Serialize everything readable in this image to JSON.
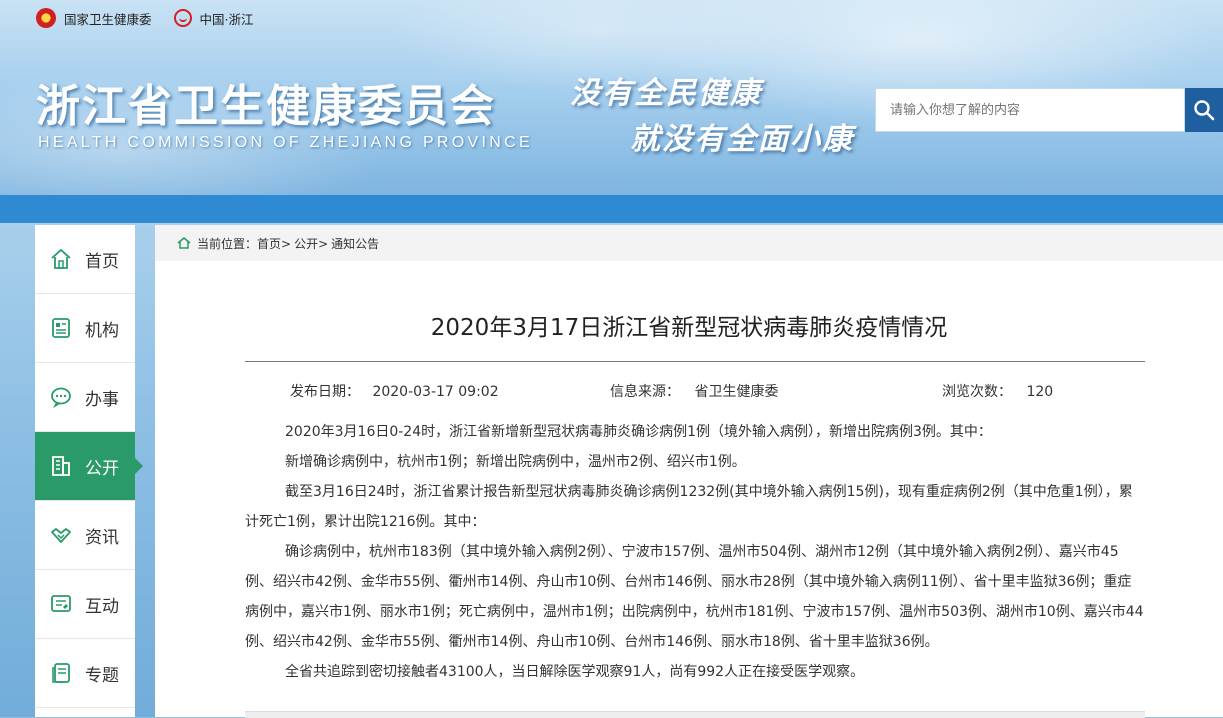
{
  "top_links": [
    {
      "label": "国家卫生健康委",
      "icon": "national-emblem-icon"
    },
    {
      "label": "中国·浙江",
      "icon": "china-zhejiang-icon"
    }
  ],
  "logo": {
    "cn": "浙江省卫生健康委员会",
    "en": "HEALTH COMMISSION OF ZHEJIANG PROVINCE"
  },
  "slogan": {
    "line1": "没有全民健康",
    "line2": "就没有全面小康"
  },
  "search": {
    "placeholder": "请输入你想了解的内容",
    "icon": "search-icon"
  },
  "nav": [
    {
      "label": "首页",
      "icon": "home-icon"
    },
    {
      "label": "机构",
      "icon": "organization-icon"
    },
    {
      "label": "办事",
      "icon": "chat-bubble-icon"
    },
    {
      "label": "公开",
      "icon": "building-icon",
      "active": true
    },
    {
      "label": "资讯",
      "icon": "handshake-icon"
    },
    {
      "label": "互动",
      "icon": "interaction-icon"
    },
    {
      "label": "专题",
      "icon": "topic-icon"
    }
  ],
  "breadcrumb": {
    "prefix": "当前位置：",
    "items": [
      "首页>",
      "公开>",
      "通知公告"
    ]
  },
  "article": {
    "title": "2020年3月17日浙江省新型冠状病毒肺炎疫情情况",
    "publish_label": "发布日期：",
    "publish_date": "2020-03-17 09:02",
    "source_label": "信息来源：",
    "source": "省卫生健康委",
    "views_label": "浏览次数：",
    "views": "120",
    "paragraphs": [
      "2020年3月16日0-24时，浙江省新增新型冠状病毒肺炎确诊病例1例（境外输入病例），新增出院病例3例。其中：",
      "新增确诊病例中，杭州市1例；新增出院病例中，温州市2例、绍兴市1例。",
      "截至3月16日24时，浙江省累计报告新型冠状病毒肺炎确诊病例1232例(其中境外输入病例15例)，现有重症病例2例（其中危重1例），累计死亡1例，累计出院1216例。其中：",
      "确诊病例中，杭州市183例（其中境外输入病例2例）、宁波市157例、温州市504例、湖州市12例（其中境外输入病例2例）、嘉兴市45例、绍兴市42例、金华市55例、衢州市14例、舟山市10例、台州市146例、丽水市28例（其中境外输入病例11例）、省十里丰监狱36例；重症病例中，嘉兴市1例、丽水市1例；死亡病例中，温州市1例；出院病例中，杭州市181例、宁波市157例、温州市503例、湖州市10例、嘉兴市44例、绍兴市42例、金华市55例、衢州市14例、舟山市10例、台州市146例、丽水市18例、省十里丰监狱36例。",
      "全省共追踪到密切接触者43100人，当日解除医学观察91人，尚有992人正在接受医学观察。"
    ]
  },
  "colors": {
    "accent_green": "#2a9a68",
    "header_blue": "#2f8ad4",
    "search_button": "#1f5f9f"
  }
}
